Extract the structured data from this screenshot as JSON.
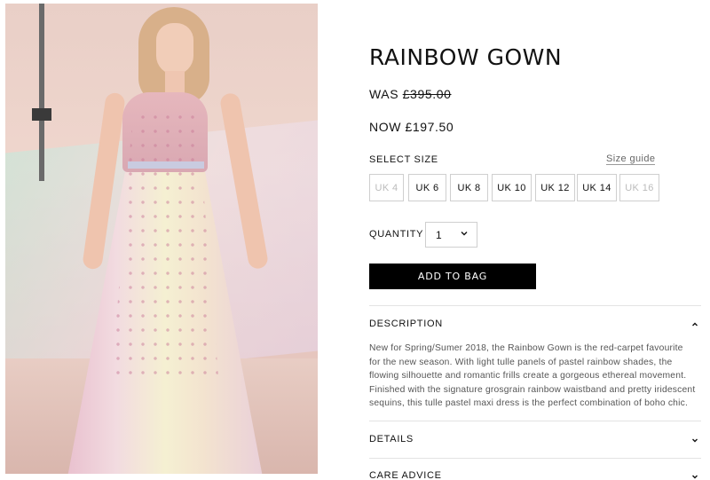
{
  "product": {
    "title": "RAINBOW GOWN",
    "was_label": "WAS",
    "was_price": "£395.00",
    "now_label": "NOW",
    "now_price": "£197.50",
    "image_alt": "Rainbow Gown product photo"
  },
  "size": {
    "label": "SELECT SIZE",
    "guide_label": "Size guide",
    "options": [
      {
        "label": "UK 4",
        "available": false
      },
      {
        "label": "UK 6",
        "available": true
      },
      {
        "label": "UK 8",
        "available": true
      },
      {
        "label": "UK 10",
        "available": true
      },
      {
        "label": "UK 12",
        "available": true
      },
      {
        "label": "UK 14",
        "available": true
      },
      {
        "label": "UK 16",
        "available": false
      }
    ]
  },
  "quantity": {
    "label": "QUANTITY",
    "value": "1",
    "icon": "chevron-down-icon"
  },
  "actions": {
    "add_to_bag": "ADD TO BAG"
  },
  "accordion": {
    "description": {
      "label": "DESCRIPTION",
      "expanded": true,
      "icon": "chevron-up-icon",
      "text": "New for Spring/Sumer 2018, the Rainbow Gown is the red-carpet favourite for the new season. With light tulle panels of pastel rainbow shades, the flowing silhouette and romantic frills create a gorgeous ethereal movement. Finished with the signature grosgrain rainbow waistband and pretty iridescent sequins, this tulle pastel maxi dress is the perfect combination of boho chic."
    },
    "details": {
      "label": "DETAILS",
      "expanded": false,
      "icon": "chevron-down-icon"
    },
    "care_advice": {
      "label": "CARE ADVICE",
      "expanded": false,
      "icon": "chevron-down-icon"
    }
  },
  "colors": {
    "text": "#111111",
    "button_bg": "#000000",
    "button_text": "#ffffff",
    "border": "#cfcfcf",
    "disabled": "#bbbbbb"
  }
}
